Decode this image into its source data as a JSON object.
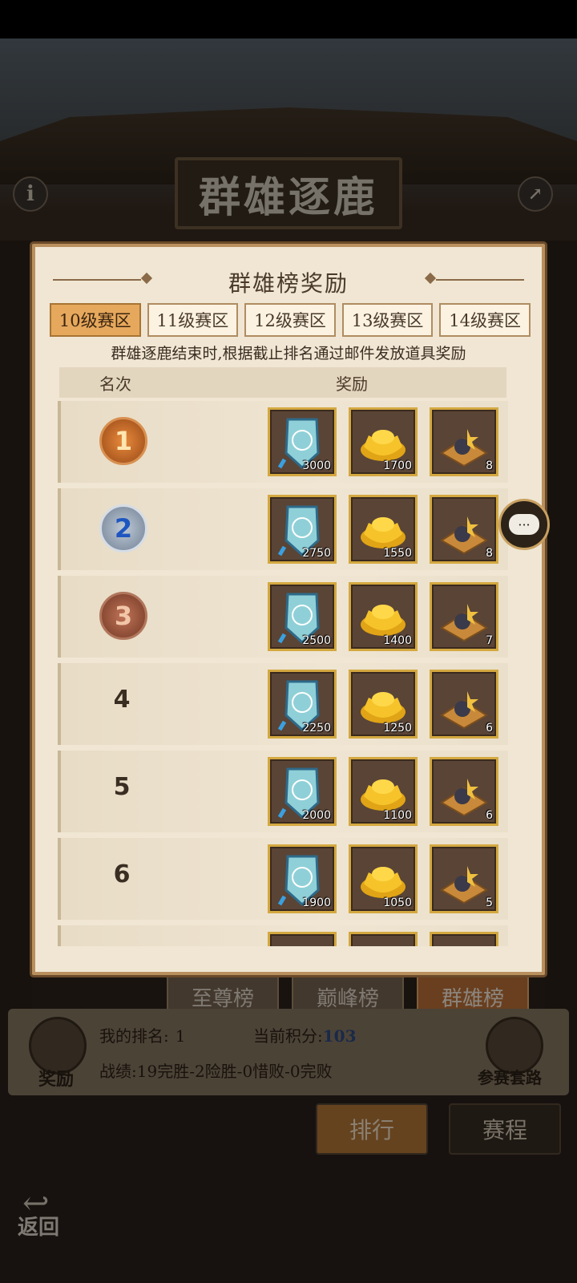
{
  "header": {
    "title": "群雄逐鹿"
  },
  "icons": {
    "info": "i"
  },
  "modal": {
    "title": "群雄榜奖励",
    "zone_tabs": [
      {
        "label": "10级赛区",
        "active": true
      },
      {
        "label": "11级赛区",
        "active": false
      },
      {
        "label": "12级赛区",
        "active": false
      },
      {
        "label": "13级赛区",
        "active": false
      },
      {
        "label": "14级赛区",
        "active": false
      }
    ],
    "notice": "群雄逐鹿结束时,根据截止排名通过邮件发放道具奖励",
    "columns": {
      "rank": "名次",
      "reward": "奖励"
    },
    "rows": [
      {
        "rank": "1",
        "medal": "gold",
        "rewards": [
          "3000",
          "1700",
          "8"
        ]
      },
      {
        "rank": "2",
        "medal": "silver",
        "rewards": [
          "2750",
          "1550",
          "8"
        ]
      },
      {
        "rank": "3",
        "medal": "bronze",
        "rewards": [
          "2500",
          "1400",
          "7"
        ]
      },
      {
        "rank": "4",
        "medal": "",
        "rewards": [
          "2250",
          "1250",
          "6"
        ]
      },
      {
        "rank": "5",
        "medal": "",
        "rewards": [
          "2000",
          "1100",
          "6"
        ]
      },
      {
        "rank": "6",
        "medal": "",
        "rewards": [
          "1900",
          "1050",
          "5"
        ]
      }
    ],
    "reward_items": [
      "banner-token",
      "gold-ingot",
      "treasure-tray"
    ]
  },
  "board_tabs": [
    {
      "label": "至尊榜",
      "active": false
    },
    {
      "label": "巅峰榜",
      "active": false
    },
    {
      "label": "群雄榜",
      "active": true
    }
  ],
  "info": {
    "my_rank_label": "我的排名:",
    "my_rank": "1",
    "score_label": "当前积分:",
    "score": "103",
    "record_label": "战绩:",
    "record": "19完胜-2险胜-0惜败-0完败",
    "reward_button": "奖励",
    "guide_button": "参赛套路"
  },
  "bottom_tabs": [
    {
      "label": "排行",
      "active": true
    },
    {
      "label": "赛程",
      "active": false
    }
  ],
  "back_label": "返回",
  "colors": {
    "accent": "#e6a85c",
    "frame": "#b98f5e",
    "score": "#2e4c86"
  }
}
